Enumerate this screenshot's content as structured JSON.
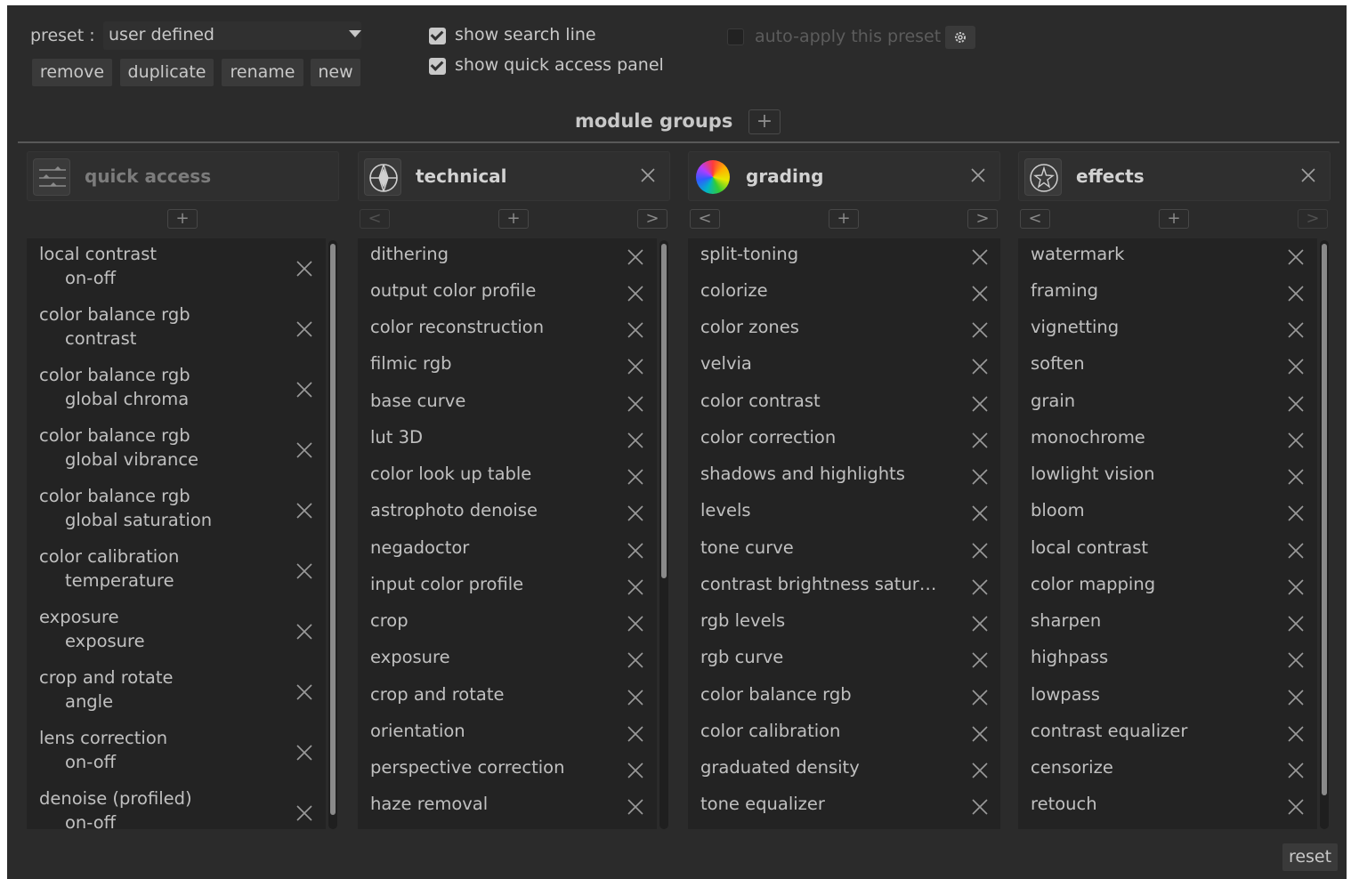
{
  "preset": {
    "label": "preset :",
    "value": "user defined"
  },
  "buttons": {
    "remove": "remove",
    "duplicate": "duplicate",
    "rename": "rename",
    "new": "new"
  },
  "options": {
    "show_search_line": {
      "label": "show search line",
      "checked": true
    },
    "show_quick_access_panel": {
      "label": "show quick access panel",
      "checked": true
    },
    "auto_apply": {
      "label": "auto-apply this preset",
      "checked": false,
      "enabled": false
    }
  },
  "icons": {
    "gear": "gear-icon",
    "close": "close-icon",
    "add": "plus-icon"
  },
  "module_groups": {
    "title": "module groups",
    "add": "+"
  },
  "nav": {
    "prev": "<",
    "add": "+",
    "next": ">"
  },
  "groups": {
    "quick_access": {
      "name": "quick access",
      "icon": "sliders-icon",
      "items": [
        {
          "module": "local contrast",
          "param": "on-off"
        },
        {
          "module": "color balance rgb",
          "param": "contrast"
        },
        {
          "module": "color balance rgb",
          "param": "global chroma"
        },
        {
          "module": "color balance rgb",
          "param": "global vibrance"
        },
        {
          "module": "color balance rgb",
          "param": "global saturation"
        },
        {
          "module": "color calibration",
          "param": "temperature"
        },
        {
          "module": "exposure",
          "param": "exposure"
        },
        {
          "module": "crop and rotate",
          "param": "angle"
        },
        {
          "module": "lens correction",
          "param": "on-off"
        },
        {
          "module": "denoise (profiled)",
          "param": "on-off"
        }
      ]
    },
    "technical": {
      "name": "technical",
      "icon": "aperture-icon",
      "items": [
        "dithering",
        "output color profile",
        "color reconstruction",
        "filmic rgb",
        "base curve",
        "lut 3D",
        "color look up table",
        "astrophoto denoise",
        "negadoctor",
        "input color profile",
        "crop",
        "exposure",
        "crop and rotate",
        "orientation",
        "perspective correction",
        "haze removal"
      ]
    },
    "grading": {
      "name": "grading",
      "icon": "color-wheel-icon",
      "items": [
        "split-toning",
        "colorize",
        "color zones",
        "velvia",
        "color contrast",
        "color correction",
        "shadows and highlights",
        "levels",
        "tone curve",
        "contrast brightness satur…",
        "rgb levels",
        "rgb curve",
        "color balance rgb",
        "color calibration",
        "graduated density",
        "tone equalizer"
      ]
    },
    "effects": {
      "name": "effects",
      "icon": "sparkle-icon",
      "items": [
        "watermark",
        "framing",
        "vignetting",
        "soften",
        "grain",
        "monochrome",
        "lowlight vision",
        "bloom",
        "local contrast",
        "color mapping",
        "sharpen",
        "highpass",
        "lowpass",
        "contrast equalizer",
        "censorize",
        "retouch"
      ]
    }
  },
  "reset": "reset"
}
